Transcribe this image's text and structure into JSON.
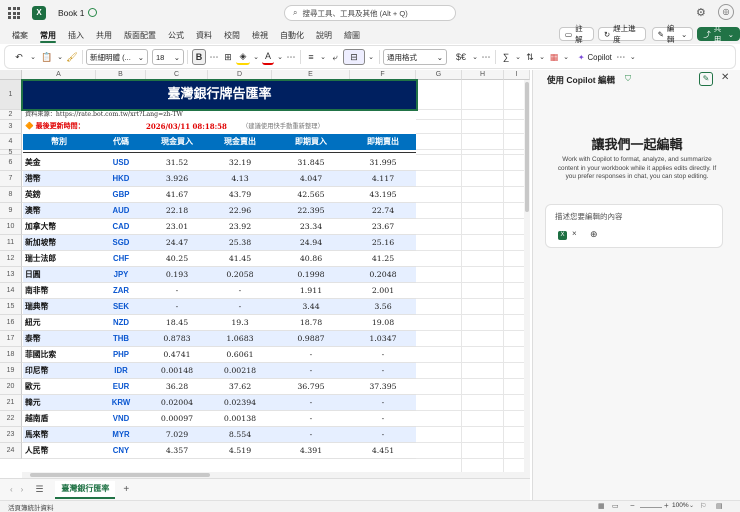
{
  "app": {
    "title": "Book 1"
  },
  "search": {
    "placeholder": "搜尋工具、工具及其他 (Alt + Q)"
  },
  "menu": {
    "tabs": [
      "檔案",
      "常用",
      "插入",
      "共用",
      "版面配置",
      "公式",
      "資料",
      "校閱",
      "檢視",
      "自動化",
      "說明",
      "繪圖"
    ],
    "active": "常用",
    "comment_label": "註解",
    "catchup_label": "趕上進度",
    "edit_label": "編輯",
    "share_label": "共用"
  },
  "ribbon": {
    "font_name": "新細明體 (...",
    "font_size": "18",
    "bold": "B",
    "number_format": "通用格式",
    "currency_symbol": "$€",
    "sum_symbol": "∑",
    "copilot_label": "Copilot"
  },
  "grid": {
    "col_letters": [
      "A",
      "B",
      "C",
      "D",
      "E",
      "F",
      "G",
      "H",
      "I"
    ],
    "row_numbers": [
      "1",
      "2",
      "3",
      "4",
      "5",
      "6",
      "7",
      "8",
      "9",
      "10",
      "11",
      "12",
      "13",
      "14",
      "15",
      "16",
      "17",
      "18",
      "19",
      "20",
      "21",
      "22",
      "23",
      "24"
    ],
    "title": "臺灣銀行牌告匯率",
    "source": "資料來源：https://rate.bot.com.tw/xrt?Lang=zh-TW",
    "updated_label": "🔶 最後更新時間：",
    "updated_time": "2026/03/11 08:18:58",
    "note": "（建議使用快手動重新整理）",
    "headers": [
      "幣別",
      "代碼",
      "現金買入",
      "現金賣出",
      "即期買入",
      "即期賣出"
    ],
    "rows": [
      [
        "美金",
        "USD",
        "31.52",
        "32.19",
        "31.845",
        "31.995"
      ],
      [
        "港幣",
        "HKD",
        "3.926",
        "4.13",
        "4.047",
        "4.117"
      ],
      [
        "英鎊",
        "GBP",
        "41.67",
        "43.79",
        "42.565",
        "43.195"
      ],
      [
        "澳幣",
        "AUD",
        "22.18",
        "22.96",
        "22.395",
        "22.74"
      ],
      [
        "加拿大幣",
        "CAD",
        "23.01",
        "23.92",
        "23.34",
        "23.67"
      ],
      [
        "新加坡幣",
        "SGD",
        "24.47",
        "25.38",
        "24.94",
        "25.16"
      ],
      [
        "瑞士法郎",
        "CHF",
        "40.25",
        "41.45",
        "40.86",
        "41.25"
      ],
      [
        "日圓",
        "JPY",
        "0.193",
        "0.2058",
        "0.1998",
        "0.2048"
      ],
      [
        "南非幣",
        "ZAR",
        "-",
        "-",
        "1.911",
        "2.001"
      ],
      [
        "瑞典幣",
        "SEK",
        "-",
        "-",
        "3.44",
        "3.56"
      ],
      [
        "紐元",
        "NZD",
        "18.45",
        "19.3",
        "18.78",
        "19.08"
      ],
      [
        "泰幣",
        "THB",
        "0.8783",
        "1.0683",
        "0.9887",
        "1.0347"
      ],
      [
        "菲國比索",
        "PHP",
        "0.4741",
        "0.6061",
        "-",
        "-"
      ],
      [
        "印尼幣",
        "IDR",
        "0.00148",
        "0.00218",
        "-",
        "-"
      ],
      [
        "歐元",
        "EUR",
        "36.28",
        "37.62",
        "36.795",
        "37.395"
      ],
      [
        "韓元",
        "KRW",
        "0.02004",
        "0.02394",
        "-",
        "-"
      ],
      [
        "越南盾",
        "VND",
        "0.00097",
        "0.00138",
        "-",
        "-"
      ],
      [
        "馬來幣",
        "MYR",
        "7.029",
        "8.554",
        "-",
        "-"
      ],
      [
        "人民幣",
        "CNY",
        "4.357",
        "4.519",
        "4.391",
        "4.451"
      ]
    ]
  },
  "sheet": {
    "name": "臺灣銀行匯率",
    "add": "+"
  },
  "status": {
    "left": "活頁簿統計資料",
    "zoom": "100%"
  },
  "copilot": {
    "title": "使用 Copilot 編輯",
    "heading": "讓我們一起編輯",
    "desc": "Work with Copilot to format, analyze, and summarize content in your workbook while it applies edits directly. If you prefer responses in chat, you can stop editing.",
    "input_placeholder": "描述您要編輯的內容"
  },
  "colors": {
    "accent": "#217346",
    "title_bg": "#002060",
    "header_bg": "#0070c0",
    "band": "#e6efff",
    "code": "#0b57d0",
    "red": "#e00000"
  }
}
